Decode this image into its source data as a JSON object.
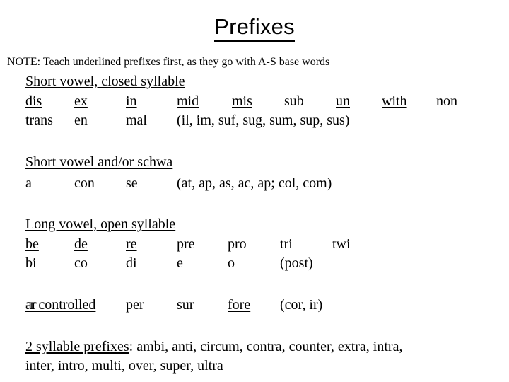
{
  "slide": {
    "title": "Prefixes",
    "note": "NOTE: Teach underlined prefixes first, as they go with A-S base words",
    "sections": [
      {
        "heading": "Short vowel, closed syllable",
        "rows": [
          [
            {
              "text": "dis",
              "underline": true
            },
            {
              "text": "ex",
              "underline": true
            },
            {
              "text": "in",
              "underline": true
            },
            {
              "text": "mid",
              "underline": true
            },
            {
              "text": "mis",
              "underline": true
            },
            {
              "text": "sub",
              "underline": false
            },
            {
              "text": "un",
              "underline": true
            },
            {
              "text": "with",
              "underline": true
            },
            {
              "text": "non",
              "underline": false
            }
          ],
          [
            {
              "text": "trans",
              "underline": false
            },
            {
              "text": "en",
              "underline": false
            },
            {
              "text": "mal",
              "underline": false
            },
            {
              "text": "(il, im, suf, sug, sum, sup, sus)",
              "underline": false
            }
          ]
        ]
      },
      {
        "heading": "Short vowel and/or schwa",
        "rows": [
          [
            {
              "text": "a",
              "underline": false
            },
            {
              "text": "con",
              "underline": false
            },
            {
              "text": "se",
              "underline": false
            },
            {
              "text": "(at, ap, as, ac, ap; col, com)",
              "underline": false
            }
          ]
        ]
      },
      {
        "heading": "Long vowel, open syllable",
        "rows": [
          [
            {
              "text": "be",
              "underline": true
            },
            {
              "text": "de",
              "underline": true
            },
            {
              "text": "re",
              "underline": true
            },
            {
              "text": "pre",
              "underline": false
            },
            {
              "text": "pro",
              "underline": false
            },
            {
              "text": "tri",
              "underline": false
            },
            {
              "text": "twi",
              "underline": false
            }
          ],
          [
            {
              "text": "bi",
              "underline": false
            },
            {
              "text": "co",
              "underline": false
            },
            {
              "text": "di",
              "underline": false
            },
            {
              "text": "e",
              "underline": false
            },
            {
              "text": "o",
              "underline": false
            },
            {
              "text": "(post)",
              "underline": false
            }
          ]
        ]
      },
      {
        "heading": "-r controlled",
        "inline": true,
        "rows": [
          [
            {
              "text": "ar",
              "underline": false
            },
            {
              "text": "per",
              "underline": false
            },
            {
              "text": "sur",
              "underline": false
            },
            {
              "text": "fore",
              "underline": true
            },
            {
              "text": "(cor, ir)",
              "underline": false
            }
          ]
        ]
      }
    ],
    "two_syllable": {
      "label": "2 syllable prefixes",
      "separator": ": ",
      "line1": "ambi, anti, circum, contra, counter, extra, intra,",
      "line2": "inter, intro, multi, over, super, ultra"
    },
    "colors": {
      "background": "#ffffff",
      "text": "#000000"
    }
  }
}
